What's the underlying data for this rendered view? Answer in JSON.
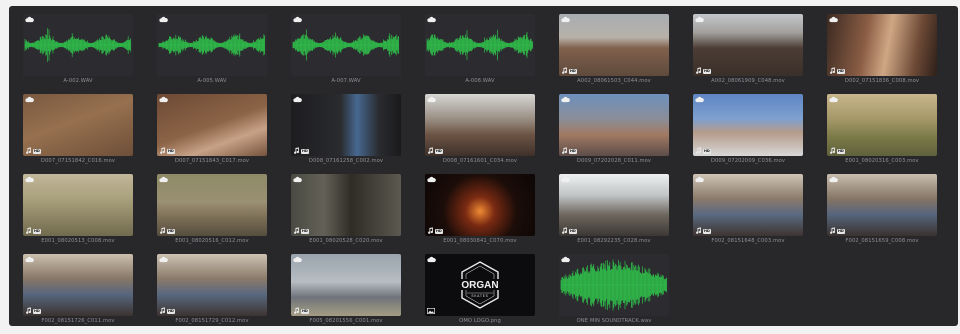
{
  "media_pool": {
    "badges": {
      "cloud_icon": "cloud-icon",
      "audio_icon": "music-note-icon",
      "image_icon": "image-icon",
      "resolution": "HD"
    },
    "logo": {
      "title": "ORGAN",
      "subtitle": "SKATES"
    },
    "colors": {
      "panel": "#28282b",
      "waveform": "#2fbf4a",
      "clip_label": "#8e8e96"
    },
    "clips": [
      {
        "name": "A-002.WAV",
        "kind": "audio"
      },
      {
        "name": "A-005.WAV",
        "kind": "audio"
      },
      {
        "name": "A-007.WAV",
        "kind": "audio"
      },
      {
        "name": "A-008.WAV",
        "kind": "audio"
      },
      {
        "name": "A002_08061503_C044.mov",
        "kind": "video",
        "bg": "linear-gradient(180deg,#a9adb3 0%,#b7b1a8 38%,#80614c 55%,#5f4a3c 100%)"
      },
      {
        "name": "A002_08061909_C048.mov",
        "kind": "video",
        "bg": "linear-gradient(180deg,#c3c6ca 0%,#a2a09d 30%,#4c3d35 55%,#3a2f29 100%)"
      },
      {
        "name": "D002_07151836_C008.mov",
        "kind": "video",
        "bg": "linear-gradient(100deg,#3c2a22 0%,#8a5d44 35%,#cfa785 55%,#6e4a36 80%,#2d1f19 100%)"
      },
      {
        "name": "D007_07151842_C016.mov",
        "kind": "video",
        "bg": "linear-gradient(160deg,#7a5940 0%,#96704f 45%,#6e4f38 100%)"
      },
      {
        "name": "D007_07151843_C017.mov",
        "kind": "video",
        "bg": "linear-gradient(160deg,#6d4a35 0%,#8b6346 50%,#c8a287 72%,#76533d 100%)"
      },
      {
        "name": "D008_07161258_C002.mov",
        "kind": "video",
        "bg": "linear-gradient(90deg,#1d1d20 0%,#2a2b2e 45%,#466890 60%,#2a2b2f 80%,#1a1a1c 100%)"
      },
      {
        "name": "D008_07161601_C034.mov",
        "kind": "video",
        "bg": "linear-gradient(180deg,#d6d6d4 0%,#9a8f84 40%,#6d5545 65%,#3e3029 100%)"
      },
      {
        "name": "D009_07202028_C011.mov",
        "kind": "video",
        "bg": "linear-gradient(180deg,#6d90bd 0%,#8a8e98 40%,#a27a63 65%,#5d4d49 100%)"
      },
      {
        "name": "D009_07202009_C036.mov",
        "kind": "video",
        "bg": "linear-gradient(180deg,#5f86c4 0%,#7ea0d0 40%,#b59b8a 62%,#d8d8d8 100%)"
      },
      {
        "name": "E001_08020316_C003.mov",
        "kind": "video",
        "bg": "linear-gradient(180deg,#c9b68c 0%,#a59868 40%,#7b7948 70%,#5f613c 100%)"
      },
      {
        "name": "E001_08020513_C008.mov",
        "kind": "video",
        "bg": "linear-gradient(180deg,#c2b79a 0%,#a9a07c 40%,#8d8564 70%,#716a4e 100%)"
      },
      {
        "name": "E001_08020516_C012.mov",
        "kind": "video",
        "bg": "linear-gradient(180deg,#8e8a66 0%,#9a9073 45%,#7c6f57 70%,#564d3e 100%)"
      },
      {
        "name": "E001_08020528_C020.mov",
        "kind": "video",
        "bg": "linear-gradient(90deg,#4a4a42 0%,#636157 30%,#2f2c26 55%,#5c5950 100%)"
      },
      {
        "name": "E001_08030841_C070.mov",
        "kind": "video",
        "bg": "radial-gradient(circle at 50% 60%,#f08a34 0%,#7a2a12 22%,#1c0d09 55%,#0b0605 100%)"
      },
      {
        "name": "E001_08292235_C028.mov",
        "kind": "video",
        "bg": "linear-gradient(180deg,#eef0f0 0%,#bfc3c4 35%,#6f6860 65%,#3b3733 100%)"
      },
      {
        "name": "F002_08151648_C003.mov",
        "kind": "video",
        "bg": "linear-gradient(180deg,#cfc4b6 0%,#8a7a6a 40%,#5b6a82 65%,#3d3430 100%)"
      },
      {
        "name": "F002_08151659_C008.mov",
        "kind": "video",
        "bg": "linear-gradient(180deg,#c9beae 0%,#857565 40%,#56657d 65%,#3a322e 100%)"
      },
      {
        "name": "F002_08151726_C011.mov",
        "kind": "video",
        "bg": "linear-gradient(180deg,#cbbfae 0%,#877766 40%,#57667e 65%,#3b332f 100%)"
      },
      {
        "name": "F002_08151729_C012.mov",
        "kind": "video",
        "bg": "linear-gradient(180deg,#cec3b3 0%,#8a7a69 40%,#596880 65%,#3c3430 100%)"
      },
      {
        "name": "F005_08201556_C001.mov",
        "kind": "video",
        "bg": "linear-gradient(180deg,#9aa3ac 0%,#b7bdc3 45%,#6f727a 70%,#8a8a7e 85%,#a49b83 100%)"
      },
      {
        "name": "OMO LOGO.png",
        "kind": "image"
      },
      {
        "name": "ONE MIN SOUNDTRACK.wav",
        "kind": "audio-big"
      }
    ]
  }
}
